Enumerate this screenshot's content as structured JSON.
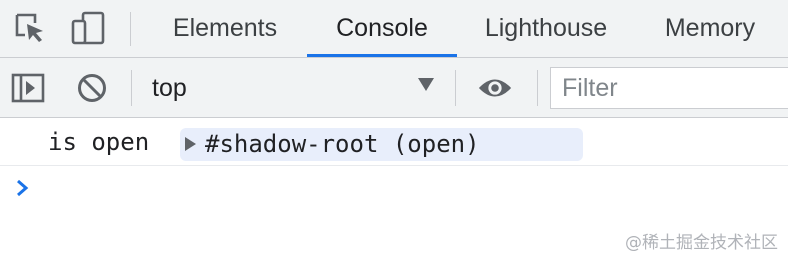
{
  "tabbar": {
    "icons": [
      "inspect-element-icon",
      "device-toolbar-icon"
    ],
    "tabs": [
      {
        "label": "Elements",
        "active": false
      },
      {
        "label": "Console",
        "active": true
      },
      {
        "label": "Lighthouse",
        "active": false
      },
      {
        "label": "Memory",
        "active": false
      }
    ],
    "accent_color": "#1a73e8"
  },
  "toolbar": {
    "icons": [
      "show-sidebar-icon",
      "clear-console-icon",
      "live-expression-eye-icon"
    ],
    "context": "top",
    "filter_placeholder": "Filter"
  },
  "console": {
    "messages": [
      {
        "text": "is open",
        "node_label": "#shadow-root (open)"
      }
    ],
    "prompt_symbol": "chevron-right-icon"
  },
  "watermark": "@稀土掘金技术社区"
}
